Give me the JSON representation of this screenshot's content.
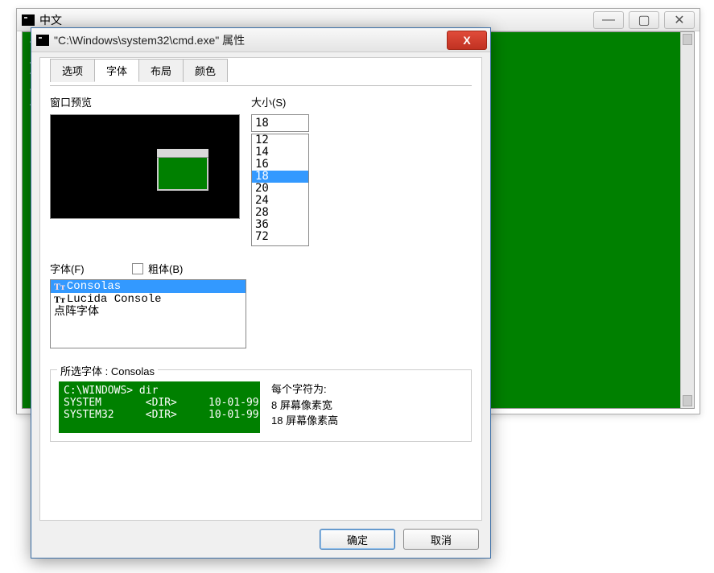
{
  "bgWindow": {
    "title": "中文",
    "minTip": "—",
    "maxTip": "▢",
    "closeTip": "✕",
    "body_lines": "T\n—\nT\nT\nT"
  },
  "dialog": {
    "title": "\"C:\\Windows\\system32\\cmd.exe\" 属性",
    "closeGlyph": "X",
    "tabs": [
      "选项",
      "字体",
      "布局",
      "颜色"
    ],
    "activeTab": 1,
    "preview_label": "窗口预览",
    "size_label": "大小(S)",
    "size_value": "18",
    "size_options": [
      "12",
      "14",
      "16",
      "18",
      "20",
      "24",
      "28",
      "36",
      "72"
    ],
    "size_selected": "18",
    "font_label": "字体(F)",
    "bold_label": "粗体(B)",
    "fonts": [
      {
        "name": "Consolas",
        "tt": "red",
        "selected": true
      },
      {
        "name": "Lucida Console",
        "tt": "black",
        "selected": false
      },
      {
        "name": "点阵字体",
        "tt": "",
        "selected": false
      }
    ],
    "selected_font_label": "所选字体 : Consolas",
    "sample_console": "C:\\WINDOWS> dir\nSYSTEM       <DIR>     10-01-99\nSYSTEM32     <DIR>     10-01-99",
    "each_char_label": "每个字符为:",
    "width_label": "  8 屏幕像素宽",
    "height_label": " 18 屏幕像素高",
    "ok": "确定",
    "cancel": "取消"
  }
}
